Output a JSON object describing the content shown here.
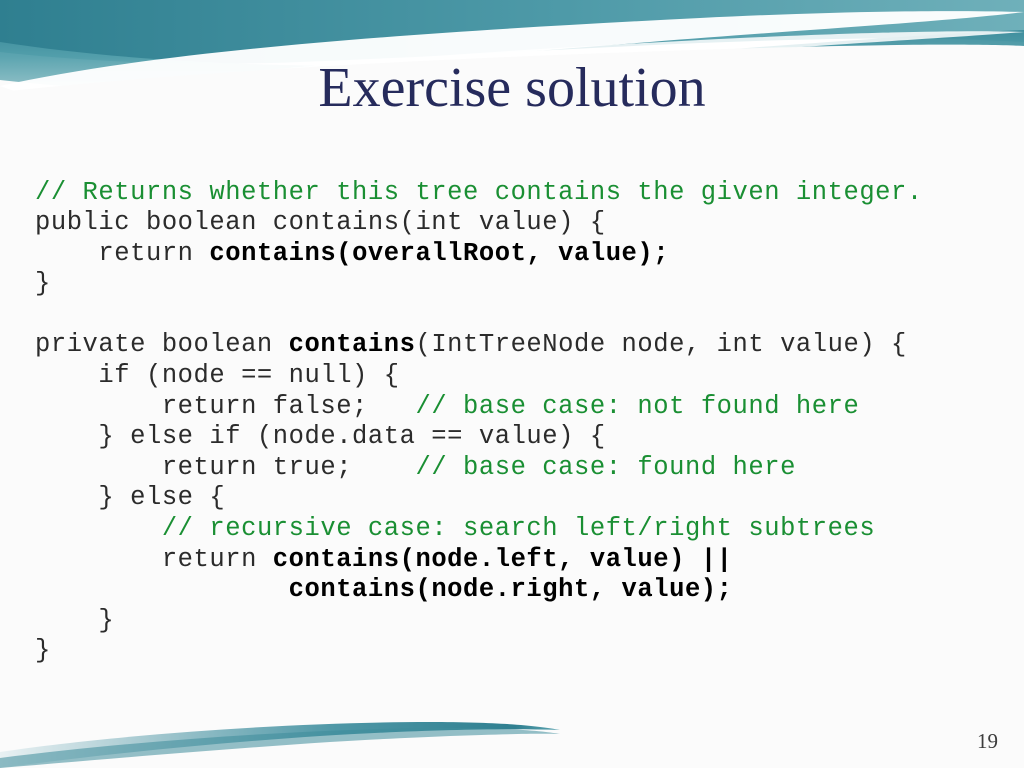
{
  "slide": {
    "title": "Exercise solution",
    "page_number": "19",
    "background_color": "#fbfbfb",
    "title_color": "#262b5c",
    "accent_color": "#4a9aa8",
    "comment_color": "#1a8f33",
    "code_color": "#2b2b2b"
  },
  "code": {
    "language": "java",
    "lines": [
      [
        {
          "t": "// Returns whether this tree contains the given integer.",
          "s": "comment"
        }
      ],
      [
        {
          "t": "public boolean contains(int value) {",
          "s": "plain"
        }
      ],
      [
        {
          "t": "    return ",
          "s": "plain"
        },
        {
          "t": "contains(overallRoot, value);",
          "s": "bold"
        }
      ],
      [
        {
          "t": "}",
          "s": "plain"
        }
      ],
      [
        {
          "t": "",
          "s": "plain"
        }
      ],
      [
        {
          "t": "private boolean ",
          "s": "plain"
        },
        {
          "t": "contains",
          "s": "bold"
        },
        {
          "t": "(IntTreeNode node, int value) {",
          "s": "plain"
        }
      ],
      [
        {
          "t": "    if (node == null) {",
          "s": "plain"
        }
      ],
      [
        {
          "t": "        return false;   ",
          "s": "plain"
        },
        {
          "t": "// base case: not found here",
          "s": "comment"
        }
      ],
      [
        {
          "t": "    } else if (node.data == value) {",
          "s": "plain"
        }
      ],
      [
        {
          "t": "        return true;    ",
          "s": "plain"
        },
        {
          "t": "// base case: found here",
          "s": "comment"
        }
      ],
      [
        {
          "t": "    } else {",
          "s": "plain"
        }
      ],
      [
        {
          "t": "        ",
          "s": "plain"
        },
        {
          "t": "// recursive case: search left/right subtrees",
          "s": "comment"
        }
      ],
      [
        {
          "t": "        return ",
          "s": "plain"
        },
        {
          "t": "contains(node.left, value) ||",
          "s": "bold"
        }
      ],
      [
        {
          "t": "            ",
          "s": "plain"
        },
        {
          "t": "    contains(node.right, value);",
          "s": "bold"
        }
      ],
      [
        {
          "t": "    }",
          "s": "plain"
        }
      ],
      [
        {
          "t": "}",
          "s": "plain"
        }
      ]
    ]
  }
}
